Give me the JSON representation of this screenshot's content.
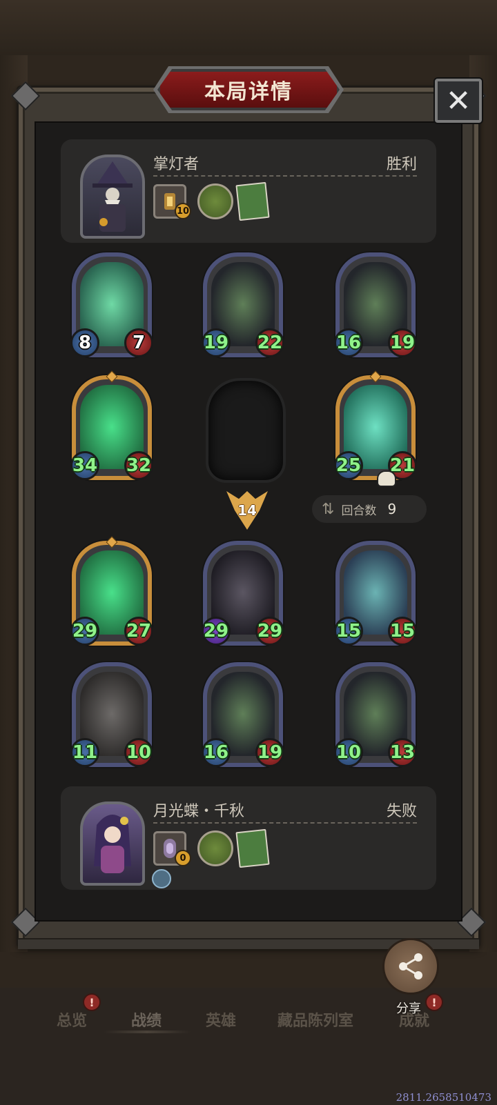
{
  "dialog": {
    "title": "本局详情",
    "close_label": "✕"
  },
  "player_top": {
    "name": "掌灯者",
    "result": "胜利",
    "lantern_level": "10"
  },
  "player_bottom": {
    "name": "月光蝶・千秋",
    "result": "失败",
    "lantern_level": "0"
  },
  "board_top": {
    "row1": [
      {
        "atk": "8",
        "hp": "7"
      },
      {
        "atk": "19",
        "hp": "22"
      },
      {
        "atk": "16",
        "hp": "19"
      }
    ],
    "row2": [
      {
        "atk": "34",
        "hp": "32"
      },
      {
        "atk": "",
        "hp": ""
      },
      {
        "atk": "25",
        "hp": "21"
      }
    ]
  },
  "board_bottom": {
    "row1": [
      {
        "atk": "29",
        "hp": "27"
      },
      {
        "atk": "29",
        "hp": "29"
      },
      {
        "atk": "15",
        "hp": "15"
      }
    ],
    "row2": [
      {
        "atk": "11",
        "hp": "10"
      },
      {
        "atk": "16",
        "hp": "19"
      },
      {
        "atk": "10",
        "hp": "13"
      }
    ]
  },
  "round": {
    "damage": "14",
    "label": "回合数",
    "value": "9"
  },
  "share": {
    "label": "分享"
  },
  "nav": {
    "items": [
      "总览",
      "战绩",
      "英雄",
      "藏品陈列室",
      "成就"
    ]
  },
  "footer": {
    "coords": "2811.2658510473"
  },
  "colors": {
    "title_plate": "#8b1c1c",
    "card_border_default": "#4d5279",
    "card_border_gold": "#c88e3b",
    "stat_text": "#8ff28a"
  }
}
